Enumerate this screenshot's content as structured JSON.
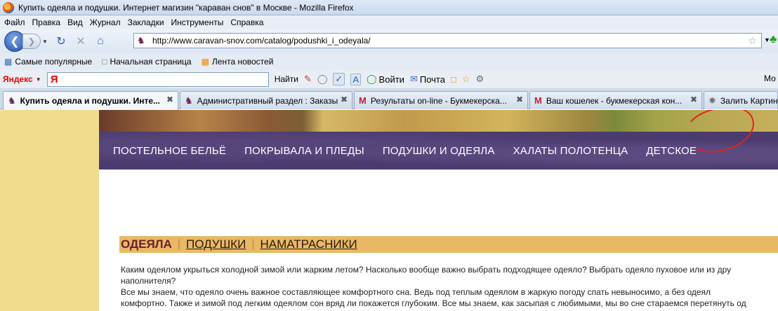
{
  "window": {
    "title": "Купить одеяла и подушки. Интернет магизин \"караван снов\" в Москве - Mozilla Firefox"
  },
  "menu": [
    "Файл",
    "Правка",
    "Вид",
    "Журнал",
    "Закладки",
    "Инструменты",
    "Справка"
  ],
  "address": {
    "url": "http://www.caravan-snov.com/catalog/podushki_i_odeyala/"
  },
  "bookmarks": [
    {
      "label": "Самые популярные",
      "icon": "bookmark-icon"
    },
    {
      "label": "Начальная страница",
      "icon": "page-icon"
    },
    {
      "label": "Лента новостей",
      "icon": "rss-icon"
    }
  ],
  "yandex": {
    "brand": "Яндекс",
    "search_button": "Найти",
    "login": "Войти",
    "mail": "Почта",
    "right_label": "Мо"
  },
  "tabs": [
    {
      "label": "Купить одеяла и подушки. Инте...",
      "icon": "camel-icon",
      "active": true
    },
    {
      "label": "Административный раздел : Заказы",
      "icon": "camel-icon",
      "active": false
    },
    {
      "label": "Результаты on-line - Букмекерска...",
      "icon": "m-icon",
      "active": false
    },
    {
      "label": "Ваш кошелек - букмекерская кон...",
      "icon": "m-icon",
      "active": false
    },
    {
      "label": "Залить Картин",
      "icon": "loading-icon",
      "active": false
    }
  ],
  "site": {
    "nav": [
      "ПОСТЕЛЬНОЕ БЕЛЬЁ",
      "ПОКРЫВАЛА И ПЛЕДЫ",
      "ПОДУШКИ И ОДЕЯЛА",
      "ХАЛАТЫ ПОЛОТЕНЦА",
      "ДЕТСКОЕ"
    ],
    "subnav": [
      "ОДЕЯЛА",
      "ПОДУШКИ",
      "НАМАТРАСНИКИ"
    ],
    "paragraphs": [
      "Каким одеялом укрыться холодной зимой или жарким летом? Насколько вообще важно выбрать подходящее одеяло? Выбрать одеяло пуховое или из дру",
      "наполнителя?",
      "Все мы знаем, что одеяло очень важное составляющее комфортного сна. Ведь под теплым одеялом в жаркую погоду спать невыносимо, а без одеял",
      "комфортно. Также и зимой под легким одеялом  сон вряд ли покажется глубоким. Все мы знаем, как засыпая с любимыми, мы во сне стараемся перетянуть од"
    ]
  }
}
